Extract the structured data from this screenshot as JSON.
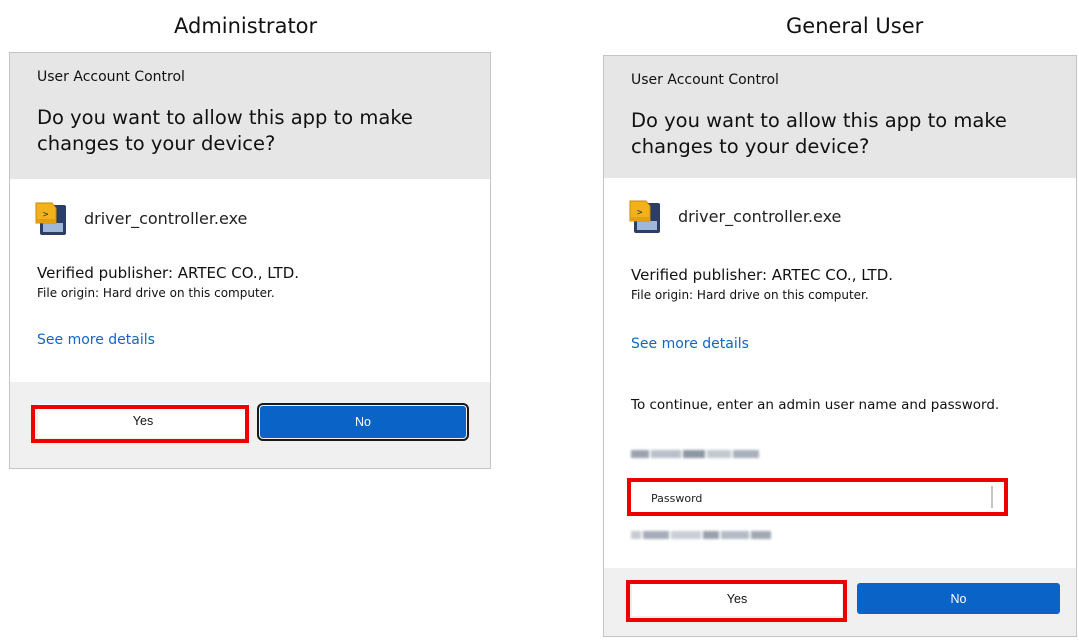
{
  "captions": {
    "admin": "Administrator",
    "general": "General User"
  },
  "admin_dialog": {
    "title": "User Account Control",
    "question": "Do you want to allow this app to make changes to your device?",
    "app_name": "driver_controller.exe",
    "app_icon": "program-file-icon",
    "publisher": "Verified publisher: ARTEC CO., LTD.",
    "origin": "File origin: Hard drive on this computer.",
    "details_link": "See more details",
    "yes_label": "Yes",
    "no_label": "No"
  },
  "general_dialog": {
    "title": "User Account Control",
    "question": "Do you want to allow this app to make changes to your device?",
    "app_name": "driver_controller.exe",
    "app_icon": "program-file-icon",
    "publisher": "Verified publisher: ARTEC CO., LTD.",
    "origin": "File origin: Hard drive on this computer.",
    "details_link": "See more details",
    "continue_prompt": "To continue, enter an admin user name and password.",
    "password_placeholder": "Password",
    "yes_label": "Yes",
    "no_label": "No"
  },
  "colors": {
    "header_bg": "#e6e6e6",
    "footer_bg": "#f0f0f0",
    "primary_button": "#0a64c8",
    "link": "#1565c0",
    "highlight": "#ee0000"
  }
}
